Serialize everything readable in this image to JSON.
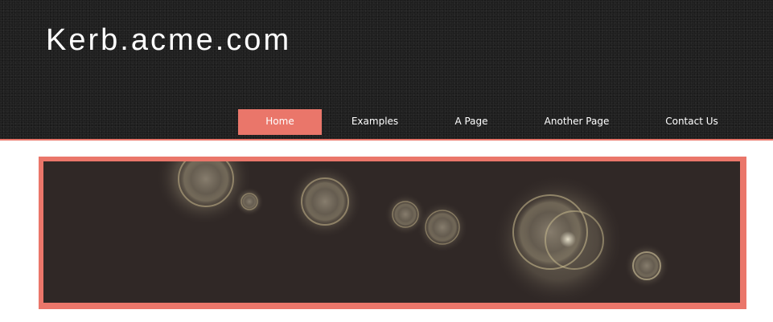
{
  "site": {
    "title": "Kerb.acme.com"
  },
  "nav": {
    "items": [
      {
        "label": "Home",
        "active": true
      },
      {
        "label": "Examples",
        "active": false
      },
      {
        "label": "A Page",
        "active": false
      },
      {
        "label": "Another Page",
        "active": false
      },
      {
        "label": "Contact Us",
        "active": false
      }
    ]
  },
  "colors": {
    "accent": "#ea766a",
    "header_bg": "#1f1f1f",
    "banner_bg": "#302826",
    "page_bg": "#ffffff"
  },
  "banner": {
    "icon": "bokeh-lights-image"
  }
}
